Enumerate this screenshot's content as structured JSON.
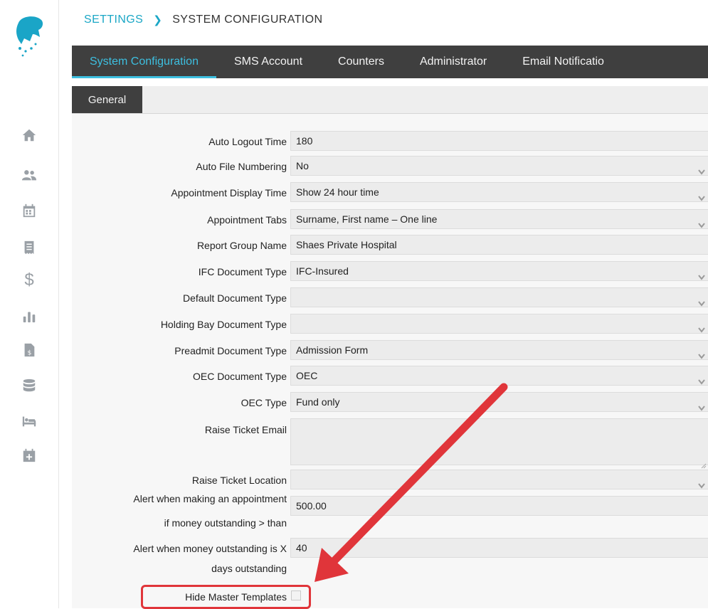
{
  "breadcrumb": {
    "parent": "SETTINGS",
    "current": "SYSTEM CONFIGURATION"
  },
  "tabs": [
    {
      "label": "System Configuration",
      "active": true
    },
    {
      "label": "SMS Account",
      "active": false
    },
    {
      "label": "Counters",
      "active": false
    },
    {
      "label": "Administrator",
      "active": false
    },
    {
      "label": "Email Notificatio",
      "active": false
    }
  ],
  "subtabs": [
    {
      "label": "General"
    }
  ],
  "form": {
    "auto_logout_time": {
      "label": "Auto Logout Time",
      "value": "180"
    },
    "auto_file_numbering": {
      "label": "Auto File Numbering",
      "value": "No"
    },
    "appointment_display_time": {
      "label": "Appointment Display Time",
      "value": "Show 24 hour time"
    },
    "appointment_tabs": {
      "label": "Appointment Tabs",
      "value": "Surname, First name – One line"
    },
    "report_group_name": {
      "label": "Report Group Name",
      "value": "Shaes Private Hospital"
    },
    "ifc_document_type": {
      "label": "IFC Document Type",
      "value": "IFC-Insured"
    },
    "default_document_type": {
      "label": "Default Document Type",
      "value": ""
    },
    "holding_bay_document_type": {
      "label": "Holding Bay Document Type",
      "value": ""
    },
    "preadmit_document_type": {
      "label": "Preadmit Document Type",
      "value": "Admission Form"
    },
    "oec_document_type": {
      "label": "OEC Document Type",
      "value": "OEC"
    },
    "oec_type": {
      "label": "OEC Type",
      "value": "Fund only"
    },
    "raise_ticket_email": {
      "label": "Raise Ticket Email",
      "value": ""
    },
    "raise_ticket_location": {
      "label": "Raise Ticket Location",
      "value": ""
    },
    "alert_appointment_money": {
      "label_line1": "Alert when making an appointment",
      "label_line2": "if money outstanding > than",
      "value": "500.00"
    },
    "alert_days_outstanding": {
      "label_line1": "Alert when money outstanding is X",
      "label_line2": "days outstanding",
      "value": "40"
    },
    "hide_master_templates": {
      "label": "Hide Master Templates",
      "checked": false
    }
  },
  "colors": {
    "accent": "#3dbfe0",
    "dark_bar": "#3f3f3f",
    "highlight": "#e0353a"
  },
  "rail_icons": [
    "logo-icon",
    "home-icon",
    "users-icon",
    "calendar-icon",
    "receipt-icon",
    "dollar-icon",
    "bar-chart-icon",
    "invoice-icon",
    "database-icon",
    "bed-icon",
    "calendar-add-icon"
  ]
}
